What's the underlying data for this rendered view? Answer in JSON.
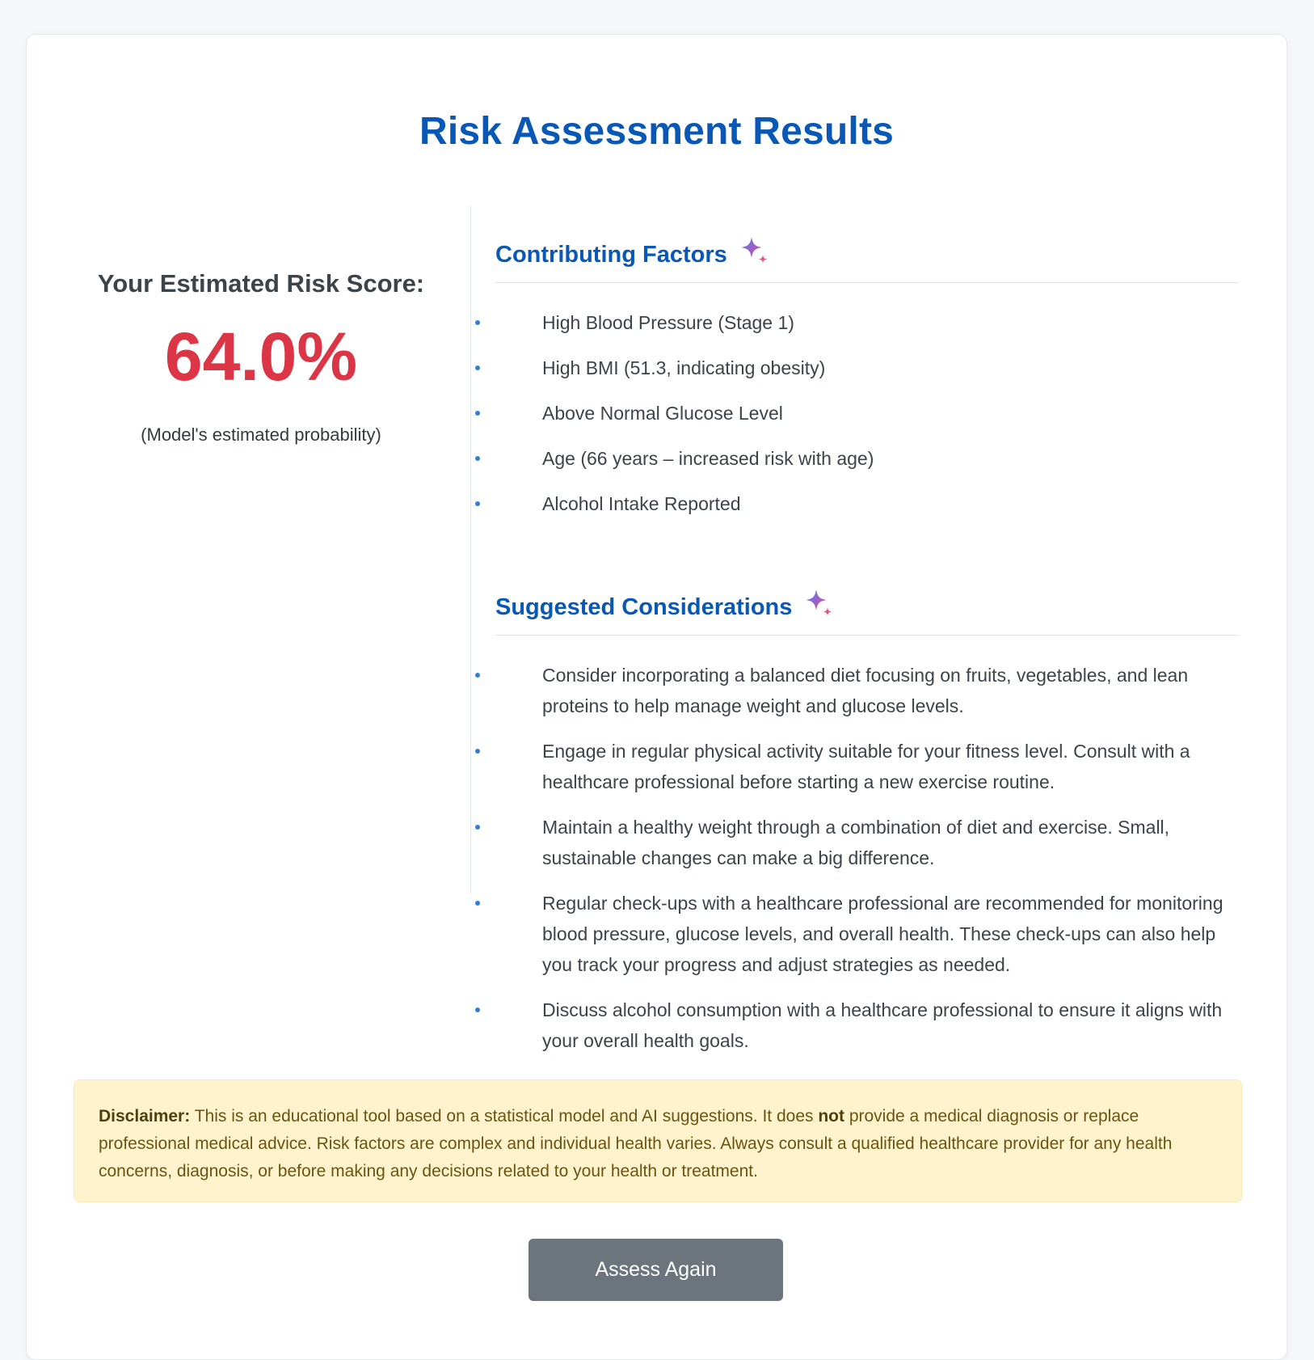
{
  "page": {
    "title": "Risk Assessment Results"
  },
  "score": {
    "label": "Your Estimated Risk Score:",
    "value": "64.0%",
    "note": "(Model's estimated probability)",
    "color": "#dc3545"
  },
  "factors": {
    "title": "Contributing Factors",
    "icon": "sparkle-icon",
    "items": [
      "High Blood Pressure (Stage 1)",
      "High BMI (51.3, indicating obesity)",
      "Above Normal Glucose Level",
      "Age (66 years – increased risk with age)",
      "Alcohol Intake Reported"
    ]
  },
  "considerations": {
    "title": "Suggested Considerations",
    "icon": "sparkle-icon",
    "items": [
      "Consider incorporating a balanced diet focusing on fruits, vegetables, and lean proteins to help manage weight and glucose levels.",
      "Engage in regular physical activity suitable for your fitness level. Consult with a healthcare professional before starting a new exercise routine.",
      "Maintain a healthy weight through a combination of diet and exercise. Small, sustainable changes can make a big difference.",
      "Regular check-ups with a healthcare professional are recommended for monitoring blood pressure, glucose levels, and overall health. These check-ups can also help you track your progress and adjust strategies as needed.",
      "Discuss alcohol consumption with a healthcare professional to ensure it aligns with your overall health goals."
    ]
  },
  "disclaimer": {
    "label": "Disclaimer:",
    "text_before": " This is an educational tool based on a statistical model and AI suggestions. It does ",
    "emphasis": "not",
    "text_after": " provide a medical diagnosis or replace professional medical advice. Risk factors are complex and individual health varies. Always consult a qualified healthcare provider for any health concerns, diagnosis, or before making any decisions related to your health or treatment."
  },
  "actions": {
    "assess_again_label": "Assess Again"
  },
  "colors": {
    "accent": "#0a58b6",
    "bullet": "#2f7fd8",
    "button": "#6c757d",
    "disclaimer_bg": "#fff3cd"
  }
}
